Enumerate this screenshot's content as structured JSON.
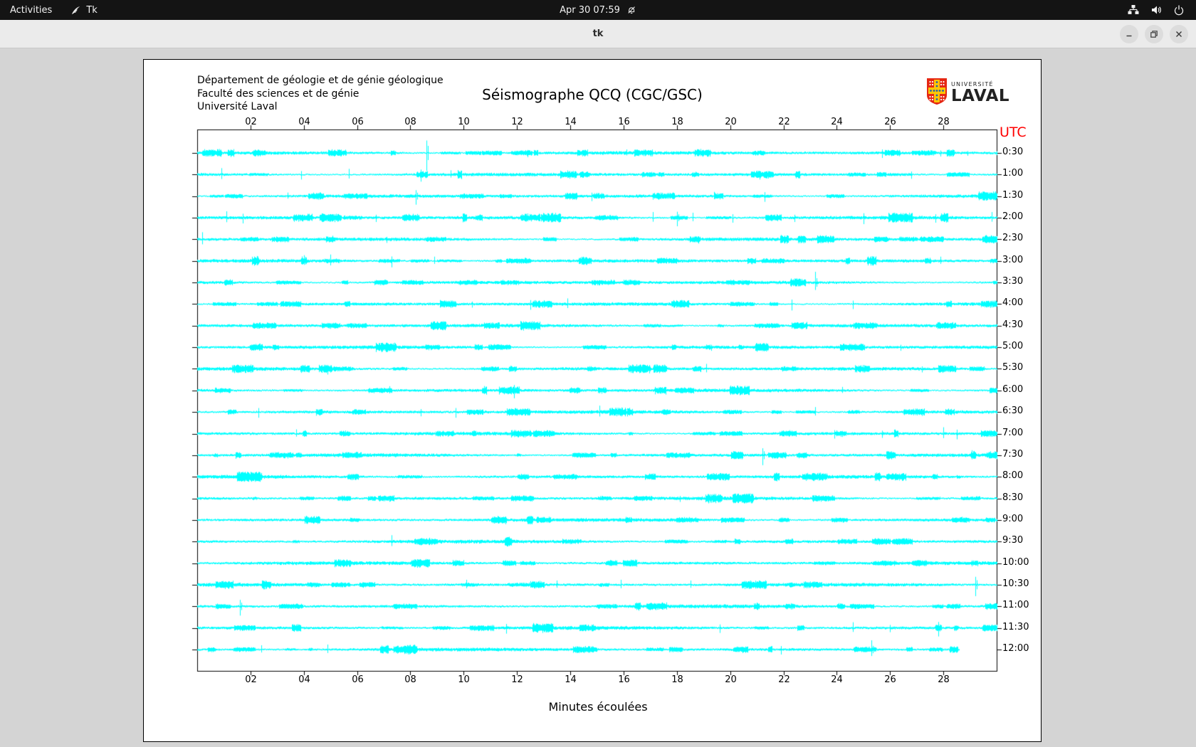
{
  "topbar": {
    "activities_label": "Activities",
    "app_label": "Tk",
    "clock": "Apr 30 07:59"
  },
  "titlebar": {
    "title": "tk"
  },
  "header": {
    "line1": "Département de géologie et de génie géologique",
    "line2": "Faculté des sciences et de génie",
    "line3": "Université Laval"
  },
  "logo": {
    "small": "UNIVERSITÉ",
    "big": "LAVAL"
  },
  "icons": [
    "tk-feather-icon",
    "notifications-muted-icon",
    "network-wired-icon",
    "volume-icon",
    "power-icon",
    "minimize-icon",
    "restore-icon",
    "close-icon",
    "laval-shield-icon"
  ],
  "colors": {
    "topbar_bg": "#141414",
    "titlebar_bg": "#ebebeb",
    "desktop_bg": "#d4d4d4",
    "canvas_bg": "#ffffff",
    "trace": "#00ffff",
    "axis": "#000000",
    "utc_red": "#ff0000",
    "logo_red": "#e52713",
    "logo_gold": "#fdc608",
    "logo_blue": "#1f63ad"
  },
  "chart_data": {
    "type": "line",
    "title": "Séismographe QCQ (CGC/GSC)",
    "xlabel": "Minutes écoulées",
    "right_axis_label": "UTC",
    "xlim": [
      0,
      30
    ],
    "x_ticks": [
      "02",
      "04",
      "06",
      "08",
      "10",
      "12",
      "14",
      "16",
      "18",
      "20",
      "22",
      "24",
      "26",
      "28"
    ],
    "grid": false,
    "trace_color": "#00ffff",
    "description": "24 half-hour seismogram traces, cyan noise bands with event spikes; spikes listed as [minute, half-height-px]",
    "rows": [
      {
        "label": "0:30",
        "spikes": [
          [
            8.6,
            25
          ],
          [
            12.4,
            6
          ],
          [
            16.1,
            5
          ],
          [
            25.7,
            7
          ],
          [
            27.9,
            5
          ],
          [
            28.9,
            4
          ]
        ]
      },
      {
        "label": "1:00",
        "spikes": [
          [
            0.9,
            9
          ],
          [
            3.9,
            7
          ],
          [
            5.7,
            8
          ],
          [
            8.4,
            10
          ],
          [
            9.5,
            6
          ],
          [
            21.1,
            7
          ],
          [
            26.8,
            6
          ]
        ]
      },
      {
        "label": "1:30",
        "spikes": [
          [
            3.4,
            5
          ],
          [
            8.2,
            12
          ],
          [
            14.8,
            7
          ],
          [
            19.4,
            6
          ],
          [
            21.3,
            8
          ]
        ]
      },
      {
        "label": "2:00",
        "spikes": [
          [
            1.1,
            9
          ],
          [
            1.7,
            8
          ],
          [
            6.7,
            6
          ],
          [
            17.1,
            8
          ],
          [
            18.0,
            12
          ],
          [
            18.6,
            7
          ],
          [
            20.1,
            7
          ],
          [
            22.4,
            6
          ],
          [
            25.0,
            9
          ],
          [
            27.7,
            7
          ],
          [
            29.8,
            8
          ]
        ]
      },
      {
        "label": "2:30",
        "spikes": [
          [
            0.2,
            10
          ],
          [
            7.1,
            5
          ],
          [
            18.8,
            6
          ],
          [
            22.0,
            5
          ]
        ]
      },
      {
        "label": "3:00",
        "spikes": [
          [
            4.0,
            8
          ],
          [
            5.0,
            9
          ],
          [
            7.3,
            9
          ],
          [
            8.9,
            6
          ],
          [
            27.9,
            6
          ]
        ]
      },
      {
        "label": "3:30",
        "spikes": [
          [
            23.2,
            15
          ]
        ]
      },
      {
        "label": "4:00",
        "spikes": [
          [
            10.3,
            5
          ],
          [
            12.5,
            8
          ],
          [
            13.9,
            8
          ],
          [
            22.3,
            9
          ],
          [
            24.6,
            7
          ]
        ]
      },
      {
        "label": "4:30",
        "spikes": []
      },
      {
        "label": "5:00",
        "spikes": [
          [
            19.3,
            5
          ],
          [
            26.4,
            5
          ]
        ]
      },
      {
        "label": "5:30",
        "spikes": [
          [
            4.9,
            8
          ],
          [
            19.1,
            7
          ],
          [
            24.9,
            5
          ],
          [
            27.2,
            5
          ]
        ]
      },
      {
        "label": "6:00",
        "spikes": [
          [
            7.2,
            6
          ],
          [
            11.9,
            11
          ],
          [
            24.2,
            5
          ]
        ]
      },
      {
        "label": "6:30",
        "spikes": [
          [
            2.3,
            8
          ],
          [
            8.4,
            6
          ],
          [
            9.7,
            8
          ],
          [
            15.1,
            9
          ],
          [
            23.2,
            7
          ]
        ]
      },
      {
        "label": "7:00",
        "spikes": [
          [
            3.7,
            6
          ],
          [
            23.9,
            7
          ],
          [
            25.7,
            6
          ],
          [
            28.0,
            9
          ],
          [
            28.5,
            8
          ]
        ]
      },
      {
        "label": "7:30",
        "spikes": [
          [
            21.2,
            14
          ]
        ]
      },
      {
        "label": "8:00",
        "spikes": []
      },
      {
        "label": "8:30",
        "spikes": [
          [
            18.1,
            5
          ]
        ]
      },
      {
        "label": "9:00",
        "spikes": []
      },
      {
        "label": "9:30",
        "spikes": [
          [
            7.3,
            9
          ]
        ]
      },
      {
        "label": "10:00",
        "spikes": []
      },
      {
        "label": "10:30",
        "spikes": [
          [
            10.1,
            7
          ],
          [
            13.5,
            6
          ],
          [
            15.9,
            7
          ],
          [
            18.5,
            6
          ],
          [
            29.2,
            16
          ]
        ]
      },
      {
        "label": "11:00",
        "spikes": [
          [
            1.6,
            13
          ]
        ]
      },
      {
        "label": "11:30",
        "spikes": [
          [
            11.6,
            8
          ],
          [
            19.6,
            7
          ],
          [
            24.6,
            8
          ],
          [
            26.0,
            6
          ],
          [
            27.8,
            12
          ]
        ]
      },
      {
        "label": "12:00",
        "spikes": [
          [
            2.4,
            6
          ],
          [
            4.9,
            7
          ],
          [
            21.9,
            7
          ],
          [
            25.3,
            13
          ]
        ],
        "end_minute": 28.6
      }
    ]
  }
}
